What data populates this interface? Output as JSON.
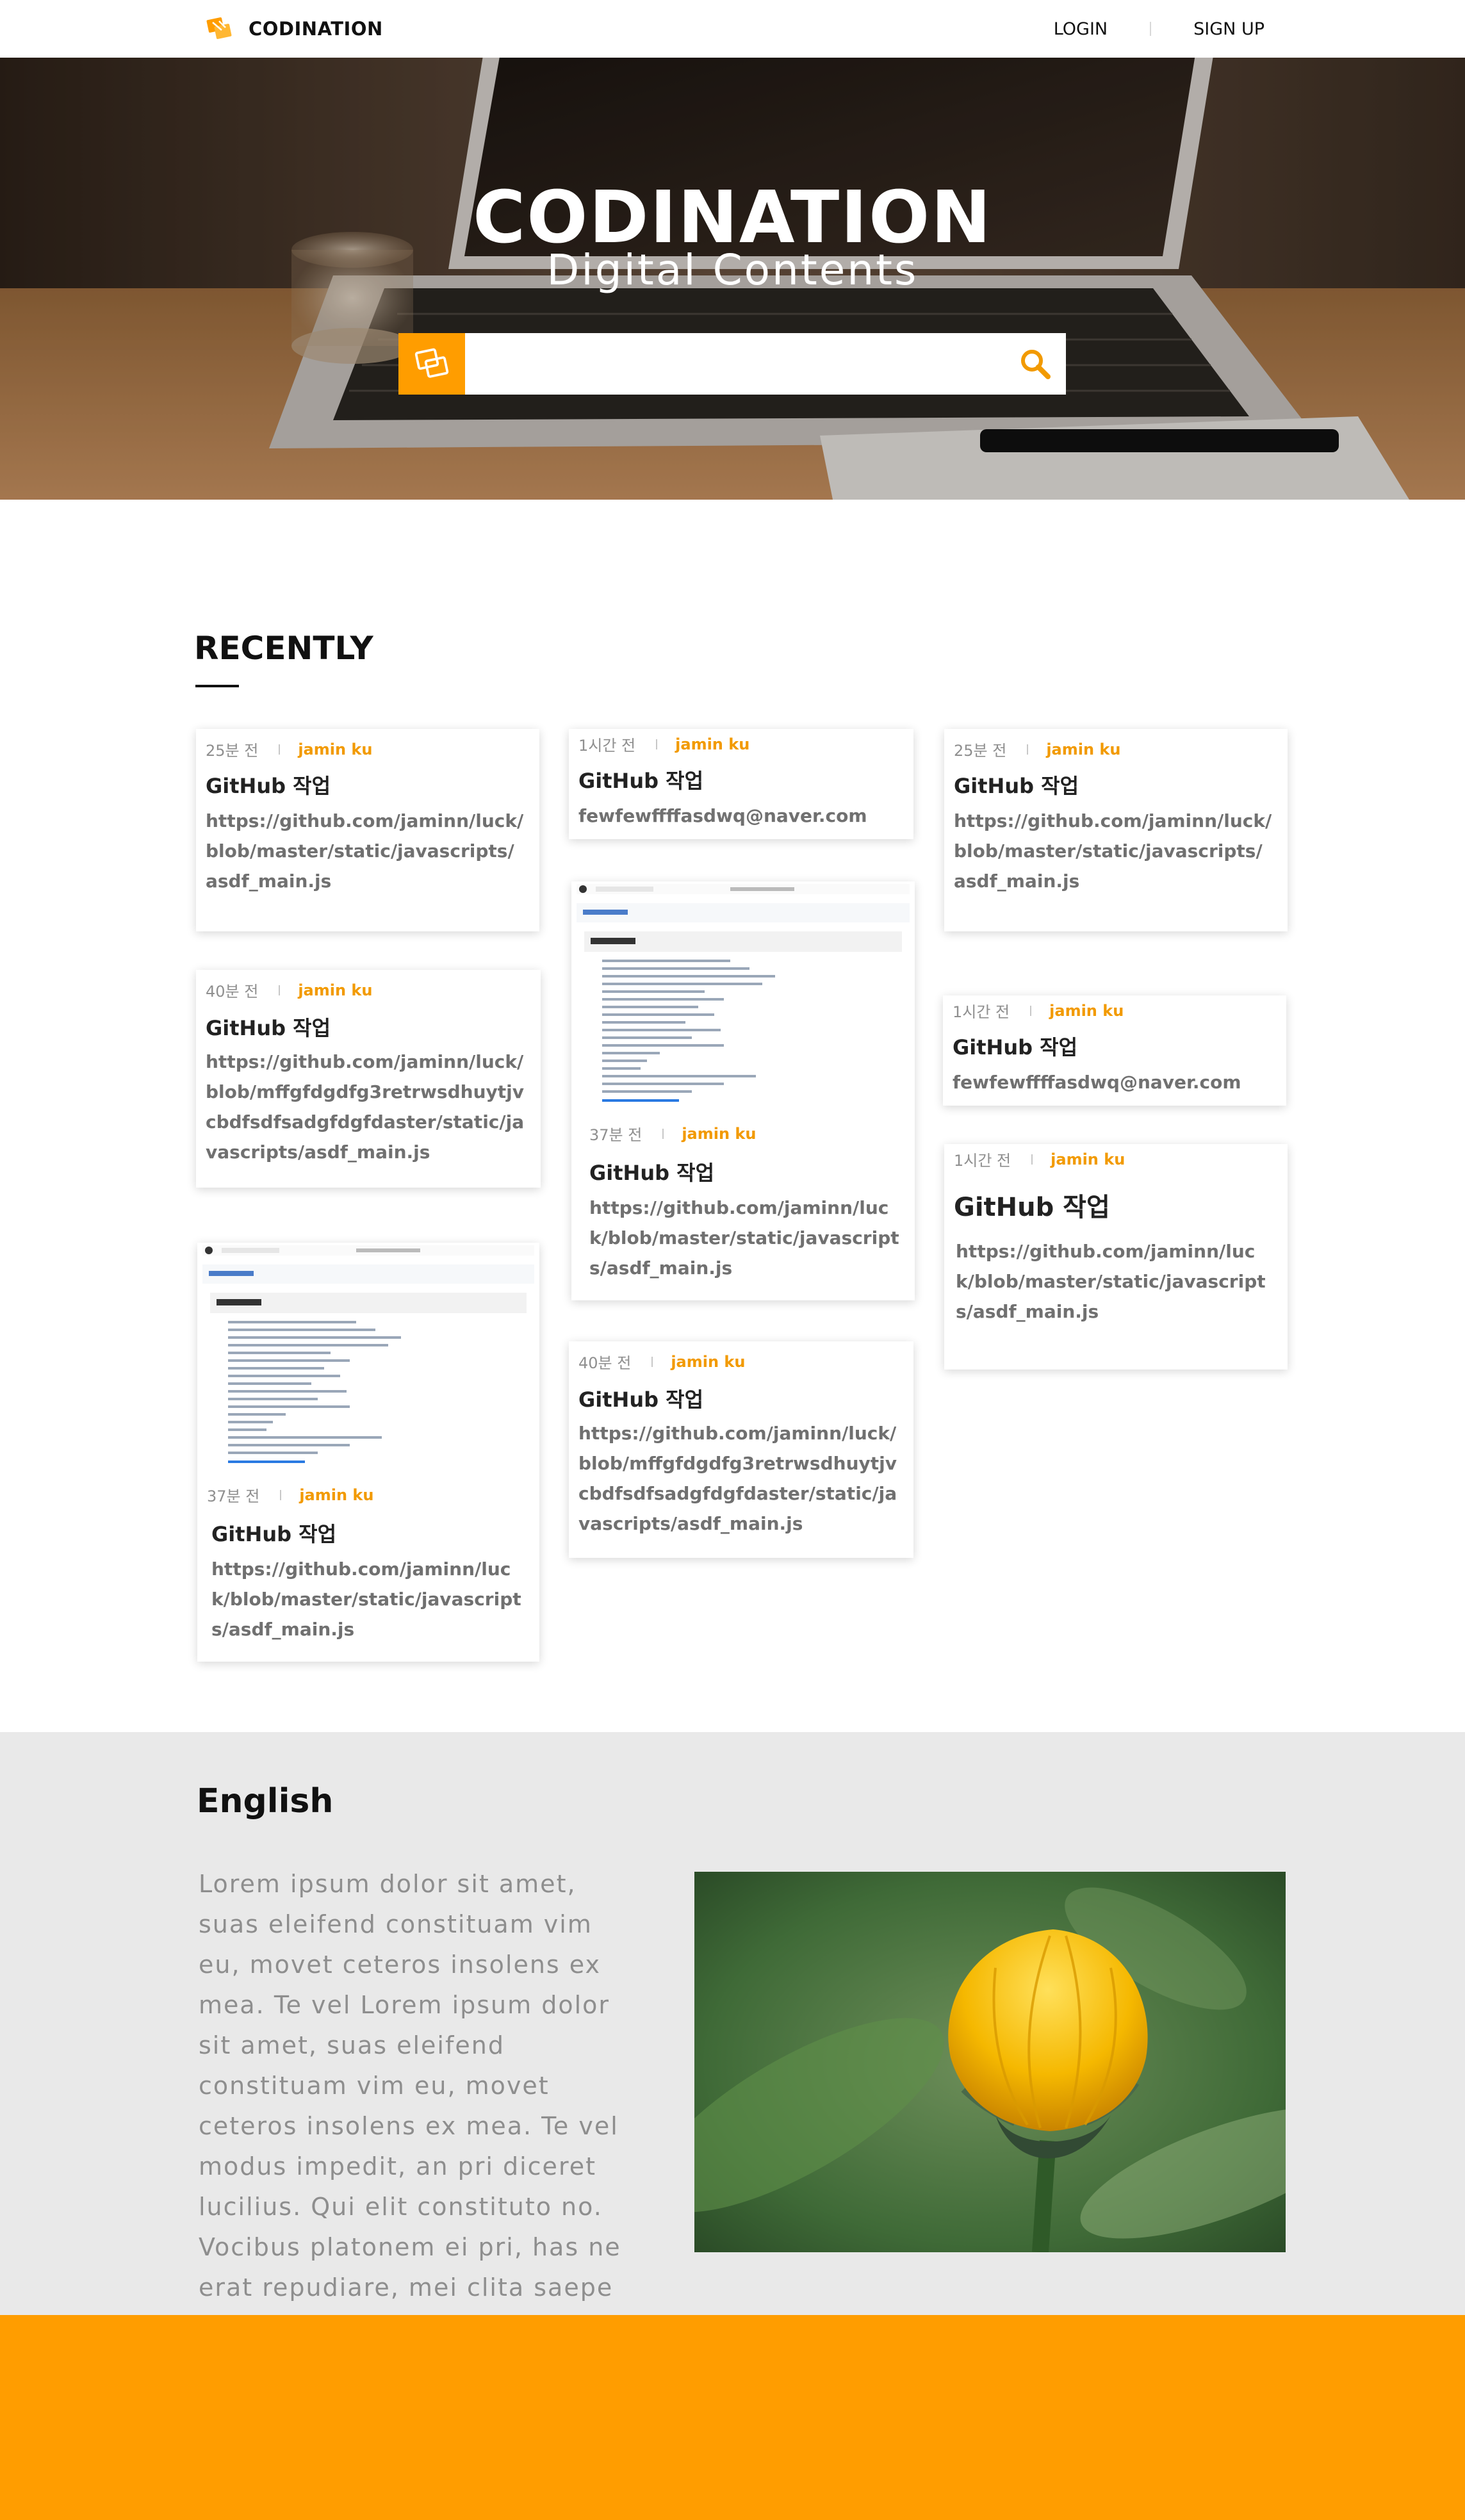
{
  "header": {
    "logo_text": "CODINATION",
    "logo_icon": "codination-logo-icon",
    "nav": {
      "login": "LOGIN",
      "signup": "SIGN UP"
    }
  },
  "hero": {
    "title": "CODINATION",
    "subtitle": "Digital Contents",
    "search": {
      "value": "",
      "placeholder": "",
      "brand_icon": "codination-logo-icon",
      "button_icon": "search-icon"
    }
  },
  "recently": {
    "title": "RECENTLY",
    "cards": [
      {
        "time": "25분 전",
        "author": "jamin ku",
        "title": "GitHub 작업",
        "body": "https://github.com/jaminn/luck/blob/master/static/javascripts/asdf_main.js"
      },
      {
        "time": "40분 전",
        "author": "jamin ku",
        "title": "GitHub 작업",
        "body": "https://github.com/jaminn/luck/blob/mffgfdgdfg3retrwsdhuytjvcbdfsdfsadgfdgfdaster/static/javascripts/asdf_main.js"
      },
      {
        "time": "37분 전",
        "author": "jamin ku",
        "title": "GitHub 작업",
        "body": "https://github.com/jaminn/luck/blob/master/static/javascripts/asdf_main.js",
        "image": "code-screenshot"
      },
      {
        "time": "1시간 전",
        "author": "jamin ku",
        "title": "GitHub 작업",
        "body": "fewfewffffasdwq@naver.com"
      },
      {
        "time": "37분 전",
        "author": "jamin ku",
        "title": "GitHub 작업",
        "body": "https://github.com/jaminn/luck/blob/master/static/javascripts/asdf_main.js",
        "image": "code-screenshot"
      },
      {
        "time": "40분 전",
        "author": "jamin ku",
        "title": "GitHub 작업",
        "body": "https://github.com/jaminn/luck/blob/mffgfdgdfg3retrwsdhuytjvcbdfsdfsadgfdgfdaster/static/javascripts/asdf_main.js"
      },
      {
        "time": "25분 전",
        "author": "jamin ku",
        "title": "GitHub 작업",
        "body": "https://github.com/jaminn/luck/blob/master/static/javascripts/asdf_main.js"
      },
      {
        "time": "1시간 전",
        "author": "jamin ku",
        "title": "GitHub 작업",
        "body": "fewfewffffasdwq@naver.com"
      },
      {
        "time": "1시간 전",
        "author": "jamin ku",
        "title": "GitHub 작업",
        "body": "https://github.com/jaminn/luck/blob/master/static/javascripts/asdf_main.js"
      }
    ]
  },
  "english": {
    "title": "English",
    "text": "Lorem ipsum dolor sit amet, suas eleifend constituam vim eu, movet ceteros insolens ex mea. Te vel Lorem ipsum dolor sit amet, suas eleifend constituam vim eu, movet ceteros insolens ex mea. Te vel modus impedit, an pri diceret lucilius. Qui elit constituto no. Vocibus platonem ei pri, has ne erat repudiare, mei clita saepe tractatos",
    "image": "yellow-flower-photo"
  },
  "colors": {
    "accent": "#ff9d00",
    "author": "#f29a00",
    "section_bg": "#e9e9e9",
    "body_text": "#707070"
  }
}
